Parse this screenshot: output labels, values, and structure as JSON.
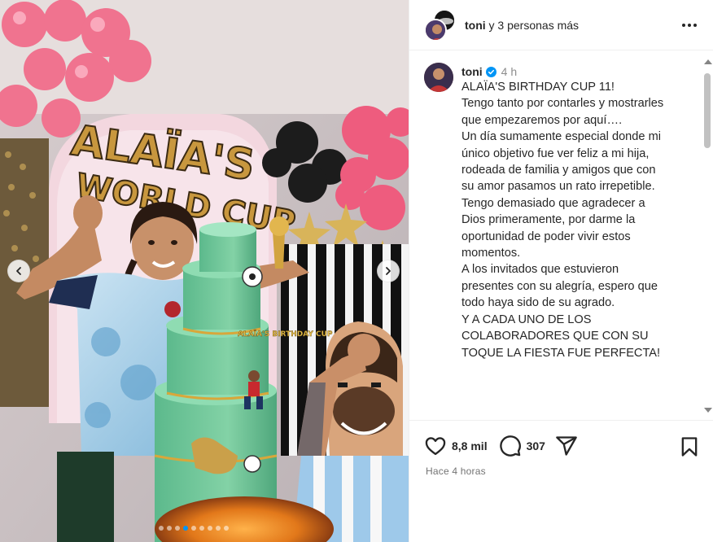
{
  "media": {
    "sign_line1": "ALAÏA'S",
    "sign_line2": "WORLD CUP",
    "cake_label": "ALAÏA'S BIRTHDAY CUP",
    "prev_icon": "chevron-left-icon",
    "next_icon": "chevron-right-icon",
    "slide_count": 9,
    "active_slide": 3
  },
  "header": {
    "username": "toni",
    "others": " y 3 personas más",
    "more_icon": "more-horizontal-icon"
  },
  "caption": {
    "username": "toni",
    "time": "4 h",
    "lines": [
      "ALAÏA'S BIRTHDAY CUP 11!",
      "Tengo tanto por contarles y mostrarles",
      "que empezaremos por aquí….",
      "Un día sumamente especial donde mi",
      "único objetivo fue ver feliz a mi hija,",
      "rodeada de familia y amigos que con",
      "su amor pasamos un rato irrepetible.",
      "Tengo demasiado que agradecer a",
      "Dios primeramente, por darme la",
      "oportunidad de poder vivir estos",
      "momentos.",
      "A los invitados que estuvieron",
      "presentes con su alegría, espero que",
      "todo haya sido de su agrado.",
      "Y A CADA UNO DE LOS",
      "COLABORADORES QUE CON SU",
      "TOQUE LA FIESTA FUE PERFECTA!"
    ]
  },
  "actions": {
    "likes": "8,8 mil",
    "comments": "307",
    "posted": "Hace 4 horas"
  },
  "colors": {
    "accent": "#0095f6",
    "verified": "#0095f6",
    "text": "#262626",
    "muted": "#737373"
  }
}
